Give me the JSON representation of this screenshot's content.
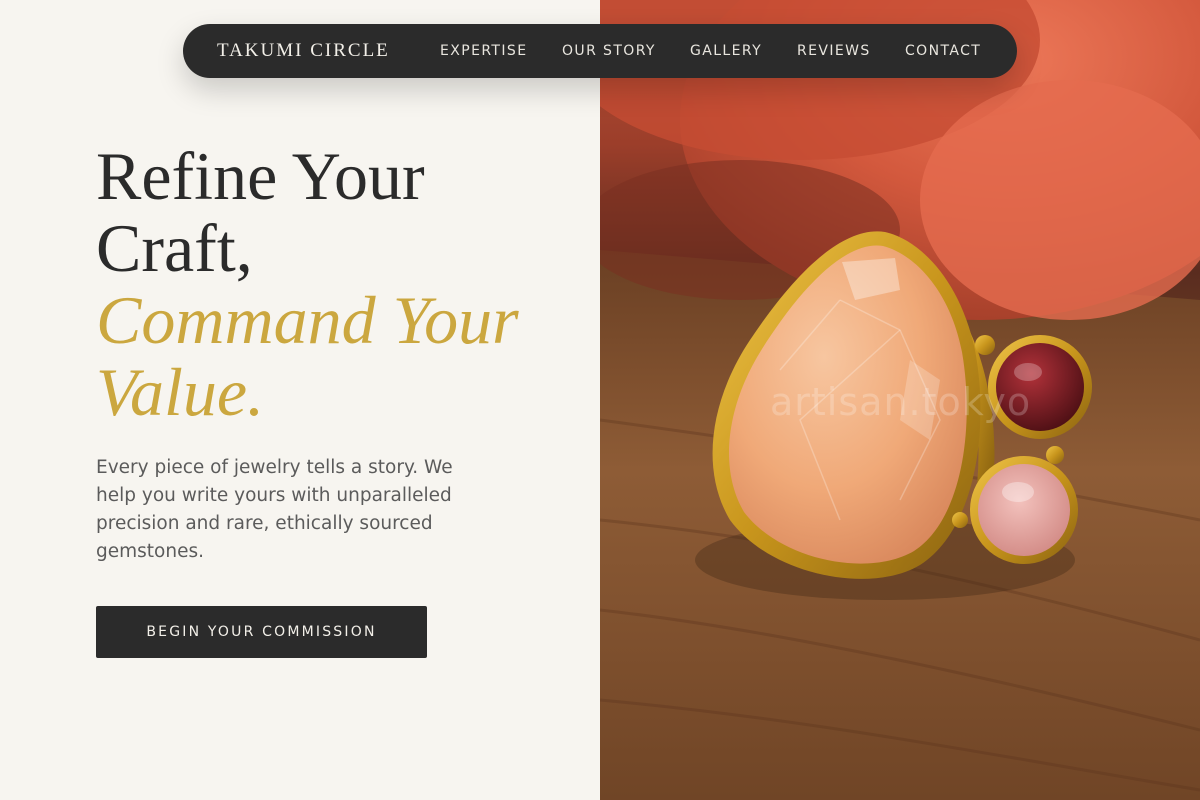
{
  "nav": {
    "brand": "TAKUMI CIRCLE",
    "links": [
      "EXPERTISE",
      "OUR STORY",
      "GALLERY",
      "REVIEWS",
      "CONTACT"
    ]
  },
  "hero": {
    "headline_line1": "Refine Your",
    "headline_line2": "Craft,",
    "headline_accent_line1": "Command Your",
    "headline_accent_line2": "Value.",
    "description": "Every piece of jewelry tells a story. We help you write yours with unparalleled precision and rare, ethically sourced gemstones.",
    "cta_label": "BEGIN YOUR COMMISSION"
  },
  "photo": {
    "watermark": "artisan.tokyo"
  },
  "colors": {
    "dark": "#2b2b2b",
    "accent_gold": "#cba73f",
    "background": "#f7f5f0",
    "body_text": "#5b5b5b"
  }
}
